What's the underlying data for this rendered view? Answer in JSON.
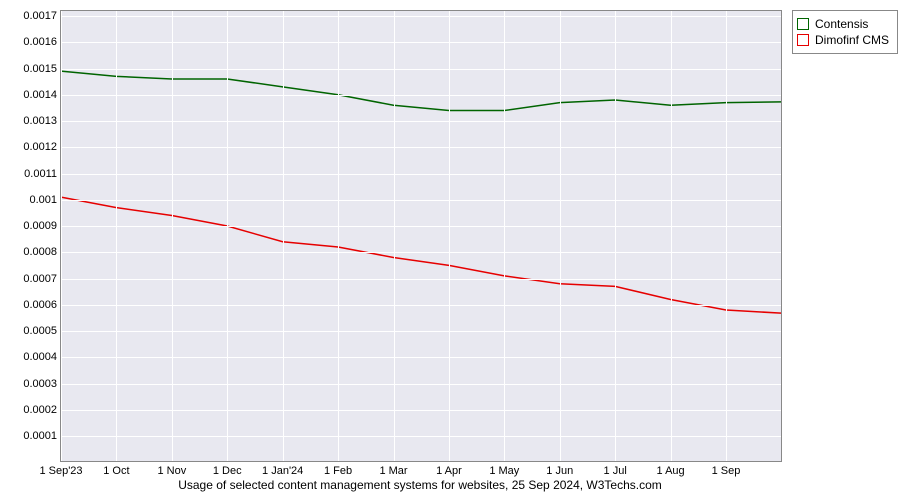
{
  "chart_data": {
    "type": "line",
    "title": "",
    "caption": "Usage of selected content management systems for websites, 25 Sep 2024, W3Techs.com",
    "xlabel": "",
    "ylabel": "",
    "ylim": [
      0.0001,
      0.0017
    ],
    "y_ticks": [
      0.0001,
      0.0002,
      0.0003,
      0.0004,
      0.0005,
      0.0006,
      0.0007,
      0.0008,
      0.0009,
      0.001,
      0.0011,
      0.0012,
      0.0013,
      0.0014,
      0.0015,
      0.0016,
      0.0017
    ],
    "y_tick_labels": [
      "0.0001",
      "0.0002",
      "0.0003",
      "0.0004",
      "0.0005",
      "0.0006",
      "0.0007",
      "0.0008",
      "0.0009",
      "0.001",
      "0.0011",
      "0.0012",
      "0.0013",
      "0.0014",
      "0.0015",
      "0.0016",
      "0.0017"
    ],
    "categories": [
      "1 Sep'23",
      "1 Oct",
      "1 Nov",
      "1 Dec",
      "1 Jan'24",
      "1 Feb",
      "1 Mar",
      "1 Apr",
      "1 May",
      "1 Jun",
      "1 Jul",
      "1 Aug",
      "1 Sep"
    ],
    "series": [
      {
        "name": "Contensis",
        "color": "#006400",
        "values": [
          0.00149,
          0.00147,
          0.00146,
          0.00146,
          0.00143,
          0.0014,
          0.00136,
          0.00134,
          0.00134,
          0.00137,
          0.00138,
          0.00136,
          0.00137
        ]
      },
      {
        "name": "Dimofinf CMS",
        "color": "#e60000",
        "values": [
          0.00101,
          0.00097,
          0.00094,
          0.0009,
          0.00084,
          0.00082,
          0.00078,
          0.00075,
          0.00071,
          0.00068,
          0.00067,
          0.00062,
          0.00058
        ]
      }
    ],
    "legend_position": "right"
  }
}
